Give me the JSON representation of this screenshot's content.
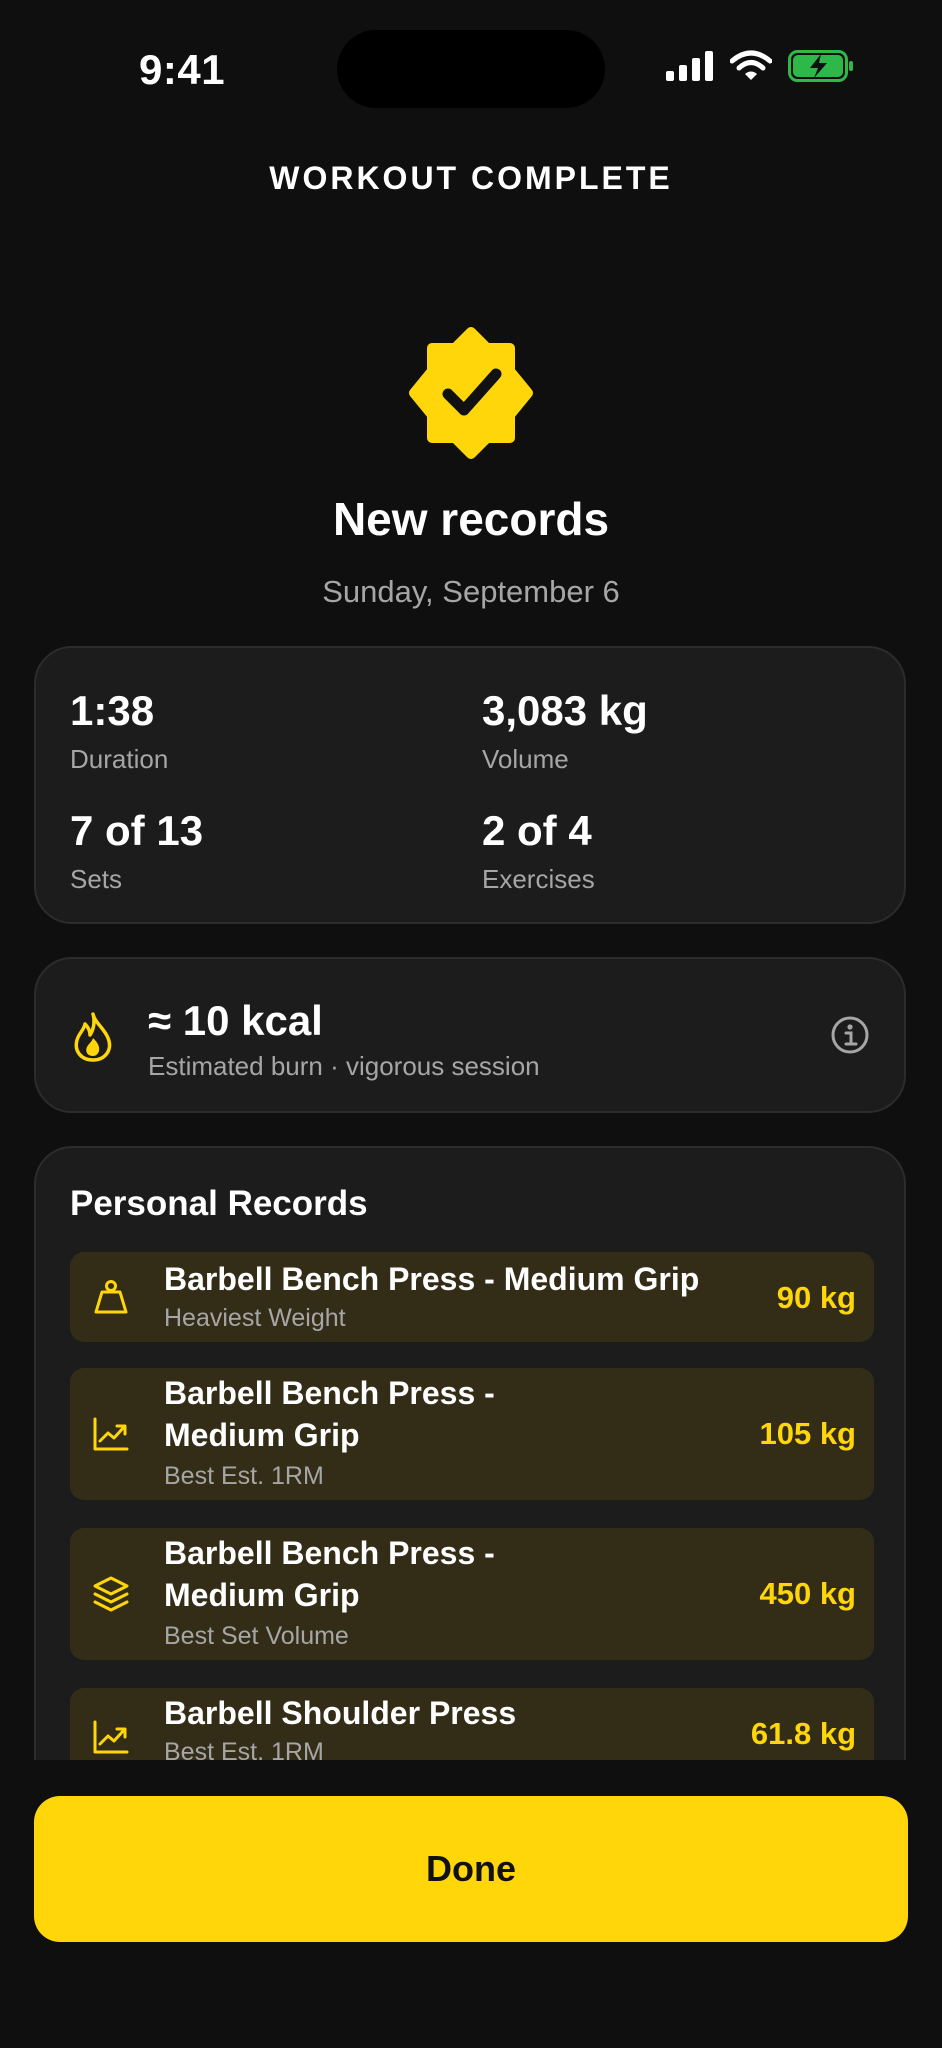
{
  "status_bar": {
    "time": "9:41"
  },
  "header": {
    "title": "WORKOUT COMPLETE"
  },
  "hero": {
    "headline": "New records",
    "date": "Sunday, September 6"
  },
  "stats": [
    {
      "value": "1:38",
      "label": "Duration"
    },
    {
      "value": "3,083 kg",
      "label": "Volume"
    },
    {
      "value": "7 of 13",
      "label": "Sets"
    },
    {
      "value": "2 of 4",
      "label": "Exercises"
    }
  ],
  "calories": {
    "value": "≈ 10 kcal",
    "subtitle": "Estimated burn · vigorous session"
  },
  "personal_records": {
    "title": "Personal Records",
    "items": [
      {
        "icon": "weight-icon",
        "name": "Barbell Bench Press - Medium Grip",
        "type": "Heaviest Weight",
        "value": "90 kg"
      },
      {
        "icon": "trend-up-icon",
        "name_line1": "Barbell Bench Press -",
        "name_line2": "Medium Grip",
        "type": "Best Est. 1RM",
        "value": "105 kg"
      },
      {
        "icon": "layers-icon",
        "name_line1": "Barbell Bench Press -",
        "name_line2": "Medium Grip",
        "type": "Best Set Volume",
        "value": "450 kg"
      },
      {
        "icon": "trend-up-icon",
        "name": "Barbell Shoulder Press",
        "type": "Best Est. 1RM",
        "value": "61.8 kg"
      }
    ]
  },
  "actions": {
    "done_label": "Done"
  },
  "colors": {
    "accent": "#ffd60a",
    "background": "#0f0f0f",
    "card": "#1c1c1c",
    "record_row": "#332d18"
  }
}
